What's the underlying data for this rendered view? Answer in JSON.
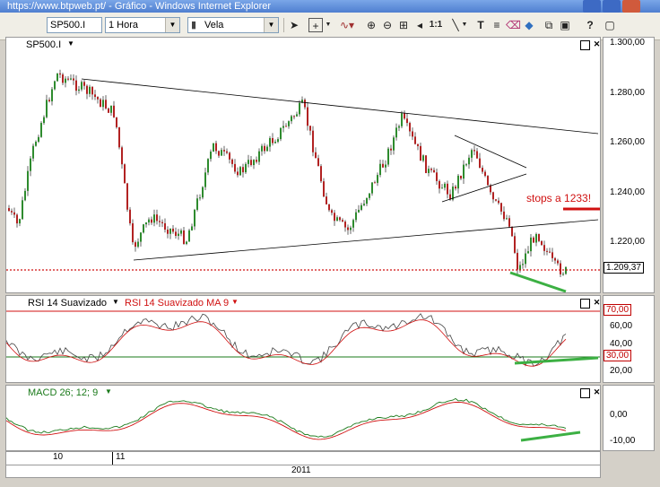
{
  "window": {
    "title": "https://www.btpweb.pt/ - Gráfico - Windows Internet Explorer"
  },
  "toolbar": {
    "symbol": "SP500.I",
    "interval": "1 Hora",
    "chart_type": "Vela",
    "zoom_label": "1:1",
    "icons": [
      "pointer-icon",
      "crosshair-icon",
      "indicator-icon",
      "zoom-in-icon",
      "zoom-out-icon",
      "fit-icon",
      "line-tool-icon",
      "text-tool-icon",
      "eraser-icon",
      "color-icon",
      "fullscreen-icon",
      "print-icon",
      "help-icon"
    ]
  },
  "price_pane": {
    "label": "SP500.I",
    "axis_ticks": [
      "1.300,00",
      "1.280,00",
      "1.260,00",
      "1.240,00",
      "1.220,00"
    ],
    "last_price_tag": "1.209,37",
    "annotation": "stops a 1233!"
  },
  "rsi_pane": {
    "label": "RSI 14 Suavizado",
    "ma_label": "RSI 14 Suavizado MA 9",
    "level_high": "70,00",
    "level_low": "30,00",
    "axis_ticks": [
      "60,00",
      "40,00",
      "20,00"
    ]
  },
  "macd_pane": {
    "label": "MACD 26; 12; 9",
    "axis_ticks": [
      "0,00",
      "-10,00"
    ]
  },
  "time_axis": {
    "labels": [
      "10",
      "11"
    ],
    "year": "2011"
  },
  "colors": {
    "support": "#3cb043",
    "stop": "#d01010",
    "candle_up": "#2e8b2e",
    "candle_down": "#b22222"
  }
}
